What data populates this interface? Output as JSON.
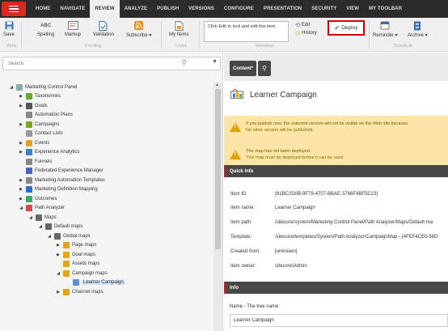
{
  "topbar": {
    "tabs": [
      "HOME",
      "NAVIGATE",
      "REVIEW",
      "ANALYZE",
      "PUBLISH",
      "VERSIONS",
      "CONFIGURE",
      "PRESENTATION",
      "SECURITY",
      "VIEW",
      "MY TOOLBAR"
    ],
    "active_tab": "REVIEW"
  },
  "ribbon": {
    "save": "Save",
    "write": "Write",
    "spelling": "Spelling",
    "markup": "Markup",
    "validation": "Validation",
    "subscribe": "Subscribe ▾",
    "proofing": "Proofing",
    "my_items": "My Items",
    "locks": "Locks",
    "lock_text": "Click Edit to lock and edit this item.",
    "edit": "Edit",
    "history": "History",
    "deploy": "Deploy",
    "workflow": "Workflow",
    "reminder": "Reminder ▾",
    "archive": "Archive ▾",
    "schedule": "Schedule"
  },
  "search": {
    "placeholder": "Search"
  },
  "tree": {
    "nodes": [
      {
        "label": "Marketing Control Panel",
        "arrow": "◢",
        "color": "#8aa"
      },
      {
        "label": "Taxonomies",
        "arrow": "▶",
        "color": "#6a3"
      },
      {
        "label": "Goals",
        "arrow": "▶",
        "color": "#555"
      },
      {
        "label": "Automation Plans",
        "arrow": "",
        "color": "#888"
      },
      {
        "label": "Campaigns",
        "arrow": "▶",
        "color": "#7a2"
      },
      {
        "label": "Contact Lists",
        "arrow": "",
        "color": "#999"
      },
      {
        "label": "Events",
        "arrow": "▶",
        "color": "#e9a21b"
      },
      {
        "label": "Experience Analytics",
        "arrow": "▶",
        "color": "#3a7bd5"
      },
      {
        "label": "Funnels",
        "arrow": "",
        "color": "#888"
      },
      {
        "label": "Federated Experience Manager",
        "arrow": "",
        "color": "#46b"
      },
      {
        "label": "Marketing Automation Templates",
        "arrow": "▶",
        "color": "#888"
      },
      {
        "label": "Marketing Definition Mapping",
        "arrow": "▶",
        "color": "#2a6fc9"
      },
      {
        "label": "Outcomes",
        "arrow": "▶",
        "color": "#3a6"
      },
      {
        "label": "Path Analyzer",
        "arrow": "◢",
        "color": "#d44"
      },
      {
        "label": "Maps",
        "arrow": "◢",
        "color": "#666"
      },
      {
        "label": "Default maps",
        "arrow": "◢",
        "color": "#666"
      },
      {
        "label": "Global maps",
        "arrow": "◢",
        "color": "#666"
      },
      {
        "label": "Page maps",
        "arrow": "▶",
        "color": "#e9a21b"
      },
      {
        "label": "Goal maps",
        "arrow": "▶",
        "color": "#e9a21b"
      },
      {
        "label": "Assets maps",
        "arrow": "",
        "color": "#e9a21b"
      },
      {
        "label": "Campaign maps",
        "arrow": "◢",
        "color": "#e9a21b"
      },
      {
        "label": "Learner Campaign",
        "arrow": "",
        "color": "#5b8fd6"
      },
      {
        "label": "Channel maps",
        "arrow": "▶",
        "color": "#e9a21b"
      }
    ]
  },
  "content": {
    "tab_label": "Content*",
    "item_title": "Learner Campaign",
    "warning1_line1": "If you publish now, the selected version will not be visible on the Web site because",
    "warning1_line2": "No other version will be published.",
    "warning2_line1": "The map has not been deployed.",
    "warning2_line2": "This map must be deployed before it can be used.",
    "quick_info_title": "Quick Info",
    "quick_info": [
      {
        "key": "Item ID:",
        "value": "{81BC2D0B-9F79-4707-BBAE-3766F4BF5C23}"
      },
      {
        "key": "Item name:",
        "value": "Learner Campaign"
      },
      {
        "key": "Item path:",
        "value": "/sitecore/system/Marketing Control Panel/Path Analyzer/Maps/Default ma"
      },
      {
        "key": "Template:",
        "value": "/sitecore/templates/System/Path Analyzer/CampaignMap - {4FEF4CE0-56D"
      },
      {
        "key": "Created from:",
        "value": "[unknown]"
      },
      {
        "key": "Item owner:",
        "value": "sitecore\\Admin"
      }
    ],
    "info_title": "Info",
    "name_label": "Name - The tree name:",
    "name_value": "Learner Campaign"
  },
  "colors": {
    "accent_red": "#dc291e",
    "topbar": "#2b2b2b",
    "warning_bg": "#fbe6a8",
    "section_bar": "#474747",
    "selection": "#cfe3f5"
  }
}
